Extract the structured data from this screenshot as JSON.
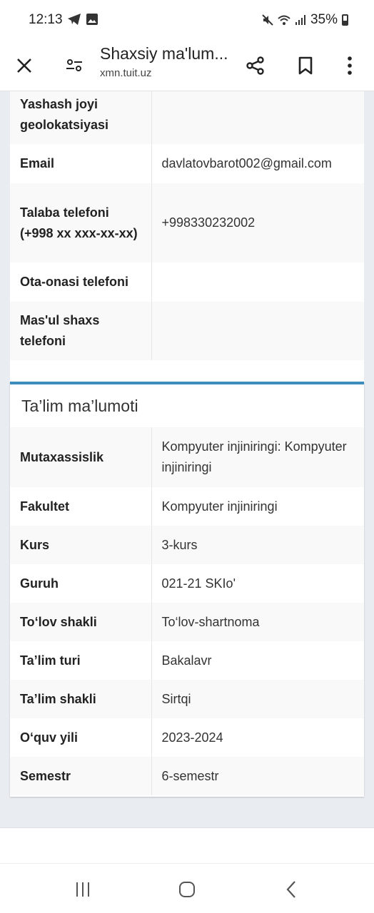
{
  "status_bar": {
    "time": "12:13",
    "battery": "35%"
  },
  "toolbar": {
    "title": "Shaxsiy ma'lum...",
    "url": "xmn.tuit.uz"
  },
  "contact_rows": [
    {
      "label": "Yashash joyi geolokatsiyasi",
      "value": ""
    },
    {
      "label": "Email",
      "value": "davlatovbarot002@gmail.com"
    },
    {
      "label": "Talaba telefoni (+998 xx xxx-xx-xx)",
      "value": "+998330232002"
    },
    {
      "label": "Ota-onasi telefoni",
      "value": ""
    },
    {
      "label": "Mas'ul shaxs telefoni",
      "value": ""
    }
  ],
  "education": {
    "title": "Ta’lim ma’lumoti",
    "rows": [
      {
        "label": "Mutaxassislik",
        "value": "Kompyuter injiniringi: Kompyuter injiniringi"
      },
      {
        "label": "Fakultet",
        "value": "Kompyuter injiniringi"
      },
      {
        "label": "Kurs",
        "value": "3-kurs"
      },
      {
        "label": "Guruh",
        "value": "021-21 SKIo'"
      },
      {
        "label": "To‘lov shakli",
        "value": "To‘lov-shartnoma"
      },
      {
        "label": "Ta’lim turi",
        "value": "Bakalavr"
      },
      {
        "label": "Ta’lim shakli",
        "value": "Sirtqi"
      },
      {
        "label": "O‘quv yili",
        "value": "2023-2024"
      },
      {
        "label": "Semestr",
        "value": "6-semestr"
      }
    ]
  },
  "colors": {
    "accent": "#3c8dbc",
    "page_background": "#e9edf2"
  }
}
